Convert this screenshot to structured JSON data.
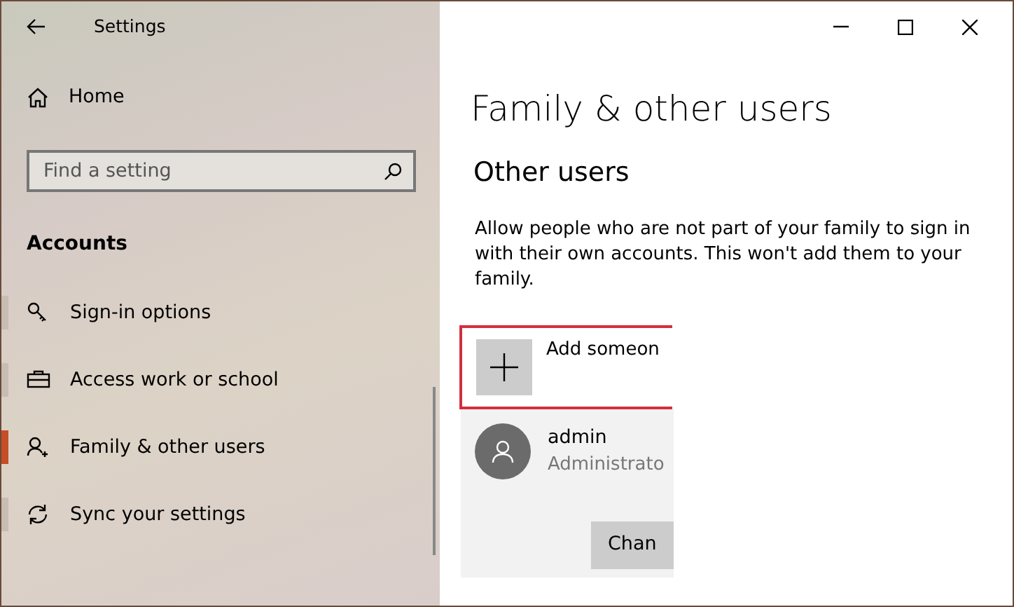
{
  "window": {
    "title": "Settings"
  },
  "sidebar": {
    "home": "Home",
    "search": {
      "placeholder": "Find a setting"
    },
    "section": "Accounts",
    "items": [
      {
        "label": "Sign-in options",
        "selected": false
      },
      {
        "label": "Access work or school",
        "selected": false
      },
      {
        "label": "Family & other users",
        "selected": true
      },
      {
        "label": "Sync your settings",
        "selected": false
      }
    ]
  },
  "content": {
    "title": "Family & other users",
    "subtitle": "Other users",
    "description": "Allow people who are not part of your family to sign in with their own accounts. This won't add them to your family.",
    "add_button": {
      "label": "Add someon"
    },
    "users": [
      {
        "name": "admin",
        "role": "Administrato",
        "button": "Chan"
      }
    ]
  }
}
